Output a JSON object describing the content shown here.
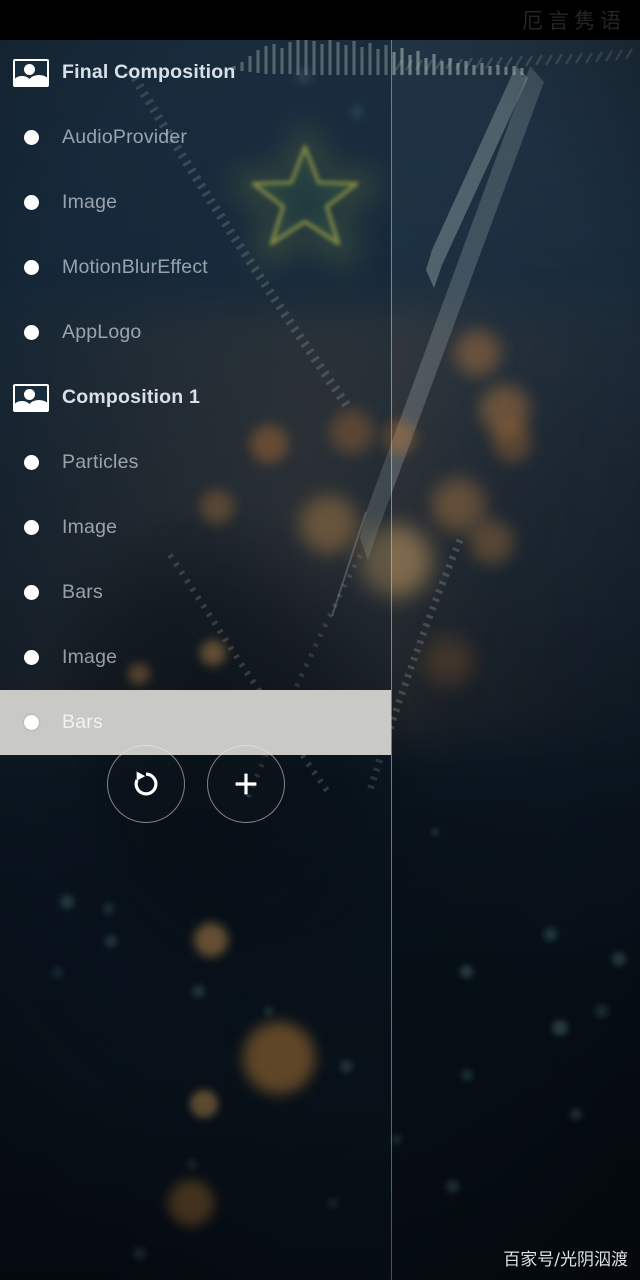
{
  "status_bar": {
    "watermark": "厄言隽语"
  },
  "drawer": {
    "items": [
      {
        "label": "Final Composition",
        "icon": "image-icon",
        "type": "composition",
        "selected": false
      },
      {
        "label": "AudioProvider",
        "icon": "bullet-dot",
        "type": "layer",
        "selected": false
      },
      {
        "label": "Image",
        "icon": "bullet-dot",
        "type": "layer",
        "selected": false
      },
      {
        "label": "MotionBlurEffect",
        "icon": "bullet-dot",
        "type": "layer",
        "selected": false
      },
      {
        "label": "AppLogo",
        "icon": "bullet-dot",
        "type": "layer",
        "selected": false
      },
      {
        "label": "Composition 1",
        "icon": "image-icon",
        "type": "composition",
        "selected": false
      },
      {
        "label": "Particles",
        "icon": "bullet-dot",
        "type": "layer",
        "selected": false
      },
      {
        "label": "Image",
        "icon": "bullet-dot",
        "type": "layer",
        "selected": false
      },
      {
        "label": "Bars",
        "icon": "bullet-dot",
        "type": "layer",
        "selected": false
      },
      {
        "label": "Image",
        "icon": "bullet-dot",
        "type": "layer",
        "selected": false
      },
      {
        "label": "Bars",
        "icon": "bullet-dot",
        "type": "layer",
        "selected": true
      }
    ],
    "selected_index": 10,
    "selection_color": "#c9c9c6"
  },
  "actions": {
    "buttons": [
      {
        "name": "reset-button",
        "icon": "rotate-ccw-icon",
        "label": "Reset"
      },
      {
        "name": "add-button",
        "icon": "plus-icon",
        "label": "Add"
      }
    ]
  },
  "footer": {
    "watermark": "百家号/光阴泅渡"
  },
  "colors": {
    "selection": "#c9c9c6",
    "status_bar": "#000000",
    "label": "#e8eef4",
    "icon": "#ffffff"
  }
}
